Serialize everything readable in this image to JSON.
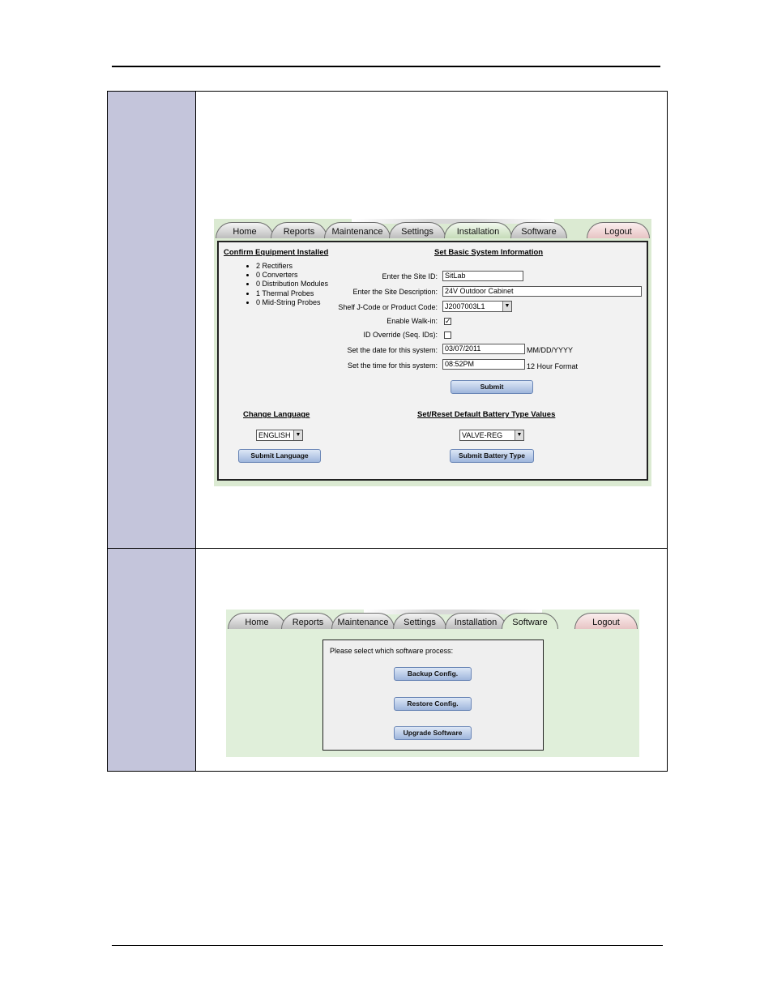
{
  "tabs1": [
    "Home",
    "Reports",
    "Maintenance",
    "Settings",
    "Installation",
    "Software",
    "Logout"
  ],
  "equipment": {
    "title": "Confirm Equipment Installed",
    "items": [
      "2 Rectifiers",
      "0 Converters",
      "0 Distribution Modules",
      "1 Thermal Probes",
      "0 Mid-String Probes"
    ]
  },
  "basic": {
    "title": "Set Basic System Information",
    "site_id_label": "Enter the Site ID:",
    "site_id_value": "SitLab",
    "site_desc_label": "Enter the Site Description:",
    "site_desc_value": "24V Outdoor Cabinet",
    "jcode_label": "Shelf J-Code or Product Code:",
    "jcode_value": "J2007003L1",
    "walkin_label": "Enable Walk-in:",
    "walkin_checked": "✓",
    "idoverride_label": "ID Override (Seq. IDs):",
    "date_label": "Set the date for this system:",
    "date_value": "03/07/2011",
    "date_format": "MM/DD/YYYY",
    "time_label": "Set the time for this system:",
    "time_value": "08:52PM",
    "time_format": "12 Hour Format",
    "submit": "Submit"
  },
  "language": {
    "title": "Change Language",
    "value": "ENGLISH",
    "submit": "Submit Language"
  },
  "battery": {
    "title": "Set/Reset Default Battery Type Values",
    "value": "VALVE-REG",
    "submit": "Submit Battery Type"
  },
  "tabs2": [
    "Home",
    "Reports",
    "Maintenance",
    "Settings",
    "Installation",
    "Software",
    "Logout"
  ],
  "software": {
    "prompt": "Please select which software process:",
    "backup": "Backup Config.",
    "restore": "Restore Config.",
    "upgrade": "Upgrade Software"
  }
}
